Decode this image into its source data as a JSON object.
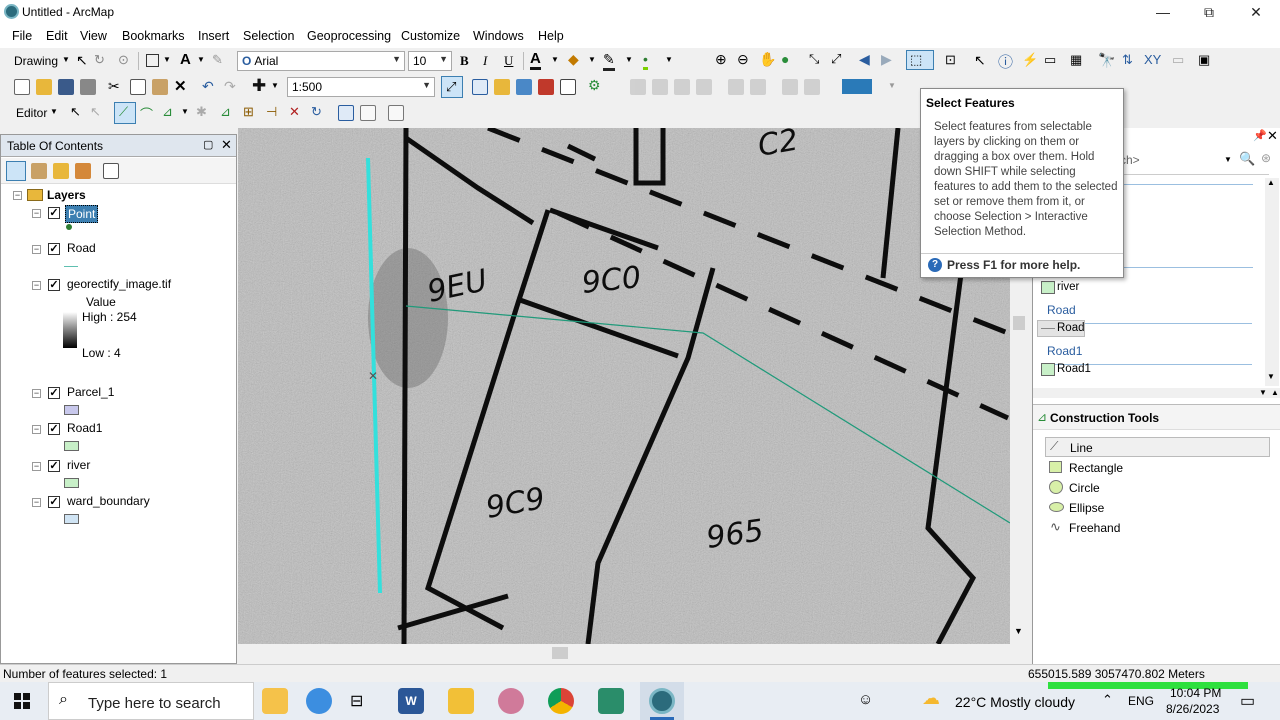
{
  "window": {
    "title": "Untitled - ArcMap",
    "minimize": "—",
    "restore": "⧉",
    "close": "✕"
  },
  "menu": [
    "File",
    "Edit",
    "View",
    "Bookmarks",
    "Insert",
    "Selection",
    "Geoprocessing",
    "Customize",
    "Windows",
    "Help"
  ],
  "toolbar": {
    "drawing_label": "Drawing",
    "font_name": "Arial",
    "font_size": "10",
    "bold": "B",
    "italic": "I",
    "underline": "U",
    "text_color_label": "A",
    "scale": "1:500",
    "editor_label": "Editor"
  },
  "toc": {
    "title": "Table Of Contents",
    "root": "Layers",
    "layers": [
      {
        "name": "Point",
        "selected": true,
        "color": "#2e7d32"
      },
      {
        "name": "Road",
        "color": "#5fbfb0"
      },
      {
        "name": "georectify_image.tif"
      },
      {
        "name": "Parcel_1",
        "color": "#c8c8ec"
      },
      {
        "name": "Road1",
        "color": "#c8f0c8"
      },
      {
        "name": "river",
        "color": "#c8f0c8"
      },
      {
        "name": "ward_boundary",
        "color": "#d0e4f4"
      }
    ],
    "raster_value_label": "Value",
    "raster_high": "High : 254",
    "raster_low": "Low : 4"
  },
  "map_labels": [
    "9EU",
    "9C0",
    "9C9",
    "965",
    "C2"
  ],
  "tooltip": {
    "title": "Select Features",
    "body": "Select features from selectable layers by clicking on them or dragging a box over them. Hold down SHIFT while selecting features to add them to the selected set or remove them from it, or choose Selection > Interactive Selection Method.",
    "help": "Press F1 for more help."
  },
  "create_features": {
    "search_placeholder": "rch>",
    "templates": [
      {
        "type": "item",
        "label": "river",
        "color": "#c8f0c8"
      },
      {
        "type": "group",
        "label": "Road"
      },
      {
        "type": "item",
        "label": "Road",
        "color": "#d8d8d8",
        "selected": true
      },
      {
        "type": "group",
        "label": "Road1"
      },
      {
        "type": "item",
        "label": "Road1",
        "color": "#c8f0c8"
      }
    ]
  },
  "construction_tools": {
    "title": "Construction Tools",
    "tools": [
      "Line",
      "Rectangle",
      "Circle",
      "Ellipse",
      "Freehand"
    ]
  },
  "status": {
    "left": "Number of features selected: 1",
    "coords": "655015.589  3057470.802 Meters"
  },
  "taskbar": {
    "search_placeholder": "Type here to search",
    "weather": "22°C  Mostly cloudy",
    "lang": "ENG",
    "time": "10:04 PM",
    "date": "8/26/2023"
  }
}
